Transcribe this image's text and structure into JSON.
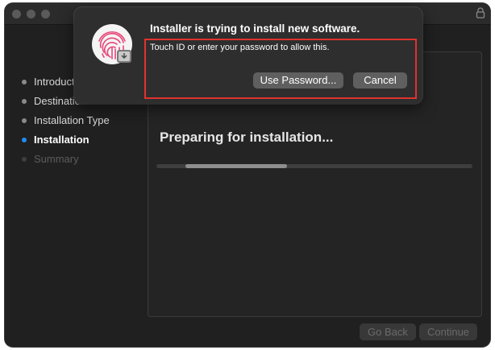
{
  "window": {
    "lock_icon": "lock-icon"
  },
  "sidebar": {
    "items": [
      {
        "label": "Introduction",
        "state": "done"
      },
      {
        "label": "Destination Select",
        "state": "done"
      },
      {
        "label": "Installation Type",
        "state": "done"
      },
      {
        "label": "Installation",
        "state": "active"
      },
      {
        "label": "Summary",
        "state": "future"
      }
    ]
  },
  "main": {
    "status": "Preparing for installation...",
    "progress": {
      "indeterminate": true
    }
  },
  "footer": {
    "back_label": "Go Back",
    "continue_label": "Continue"
  },
  "dialog": {
    "title": "Installer is trying to install new software.",
    "message": "Touch ID or enter your password to allow this.",
    "use_password_label": "Use Password...",
    "cancel_label": "Cancel",
    "icon": "touch-id-fingerprint-icon"
  },
  "colors": {
    "accent": "#1f8cf5",
    "fingerprint": "#e8467a",
    "highlight": "#e0322f"
  }
}
